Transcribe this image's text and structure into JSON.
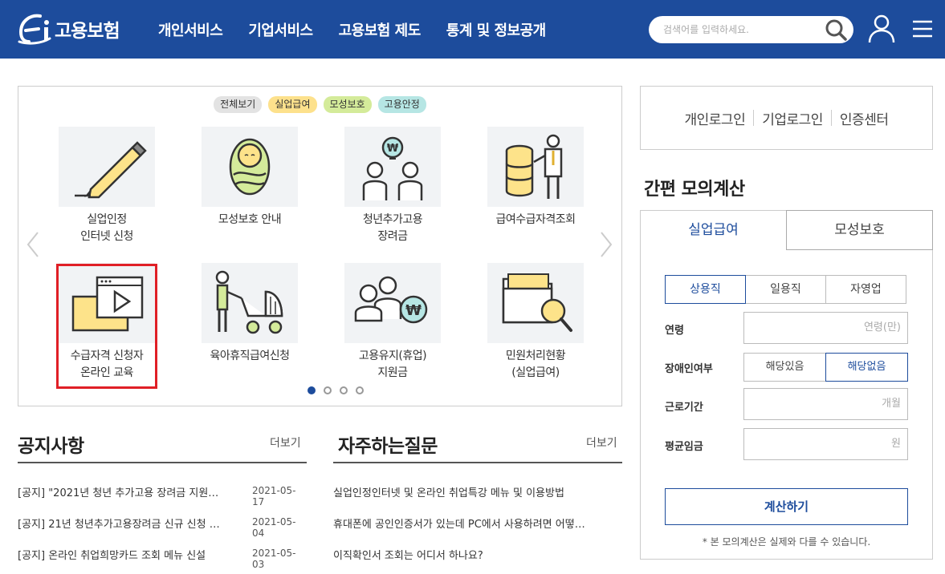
{
  "header": {
    "logo_text": "고용보험",
    "nav": [
      "개인서비스",
      "기업서비스",
      "고용보험 제도",
      "통계 및 정보공개"
    ],
    "search_placeholder": "검색어를 입력하세요."
  },
  "slider": {
    "filters": [
      "전체보기",
      "실업급여",
      "모성보호",
      "고용안정"
    ],
    "cards": [
      {
        "icon": "pencil-icon",
        "lines": [
          "실업인정",
          "인터넷 신청"
        ]
      },
      {
        "icon": "baby-icon",
        "lines": [
          "모성보호 안내"
        ]
      },
      {
        "icon": "won-people-icon",
        "lines": [
          "청년추가고용",
          "장려금"
        ]
      },
      {
        "icon": "coin-stack-icon",
        "lines": [
          "급여수급자격조회"
        ]
      },
      {
        "icon": "video-play-icon",
        "lines": [
          "수급자격 신청자",
          "온라인 교육"
        ]
      },
      {
        "icon": "stroller-icon",
        "lines": [
          "육아휴직급여신청"
        ]
      },
      {
        "icon": "people-won-icon",
        "lines": [
          "고용유지(휴업)",
          "지원금"
        ]
      },
      {
        "icon": "folder-search-icon",
        "lines": [
          "민원처리현황",
          "(실업급여)"
        ]
      }
    ]
  },
  "notice": {
    "title": "공지사항",
    "more": "더보기",
    "items": [
      {
        "text": "[공지] \"2021년 청년 추가고용 장려금 지원…",
        "date": "2021-05-17"
      },
      {
        "text": "[공지] 21년 청년추가고용장려금 신규 신청 …",
        "date": "2021-05-04"
      },
      {
        "text": "[공지] 온라인 취업희망카드 조회 메뉴 신설",
        "date": "2021-05-03"
      }
    ]
  },
  "faq": {
    "title": "자주하는질문",
    "more": "더보기",
    "items": [
      "실업인정인터넷 및 온라인 취업특강 메뉴 및 이용방법",
      "휴대폰에 공인인증서가 있는데 PC에서 사용하려면 어떻…",
      "이직확인서 조회는 어디서 하나요?"
    ]
  },
  "login": [
    "개인로그인",
    "기업로그인",
    "인증센터"
  ],
  "calc": {
    "title": "간편 모의계산",
    "tabs": [
      "실업급여",
      "모성보호"
    ],
    "types": [
      "상용직",
      "일용직",
      "자영업"
    ],
    "age_label": "연령",
    "age_unit": "연령(만)",
    "disability_label": "장애인여부",
    "disability_options": [
      "해당있음",
      "해당없음"
    ],
    "period_label": "근로기간",
    "period_unit": "개월",
    "wage_label": "평균임금",
    "wage_unit": "원",
    "button": "계산하기",
    "note": "* 본 모의계산은 실제와 다를 수 있습니다."
  },
  "colors": {
    "brand": "#1d4c9c",
    "highlight": "#e01f26"
  }
}
